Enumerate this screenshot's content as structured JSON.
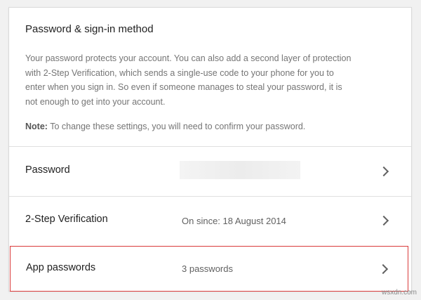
{
  "section": {
    "title": "Password & sign-in method",
    "description": "Your password protects your account. You can also add a second layer of protection with 2-Step Verification, which sends a single-use code to your phone for you to enter when you sign in. So even if someone manages to steal your password, it is not enough to get into your account.",
    "note_label": "Note:",
    "note_text": " To change these settings, you will need to confirm your password."
  },
  "rows": [
    {
      "label": "Password",
      "value": ""
    },
    {
      "label": "2-Step Verification",
      "value": "On since: 18 August 2014"
    },
    {
      "label": "App passwords",
      "value": "3 passwords"
    }
  ],
  "highlight_color": "#d93b3b",
  "watermark": "wsxdn.com"
}
